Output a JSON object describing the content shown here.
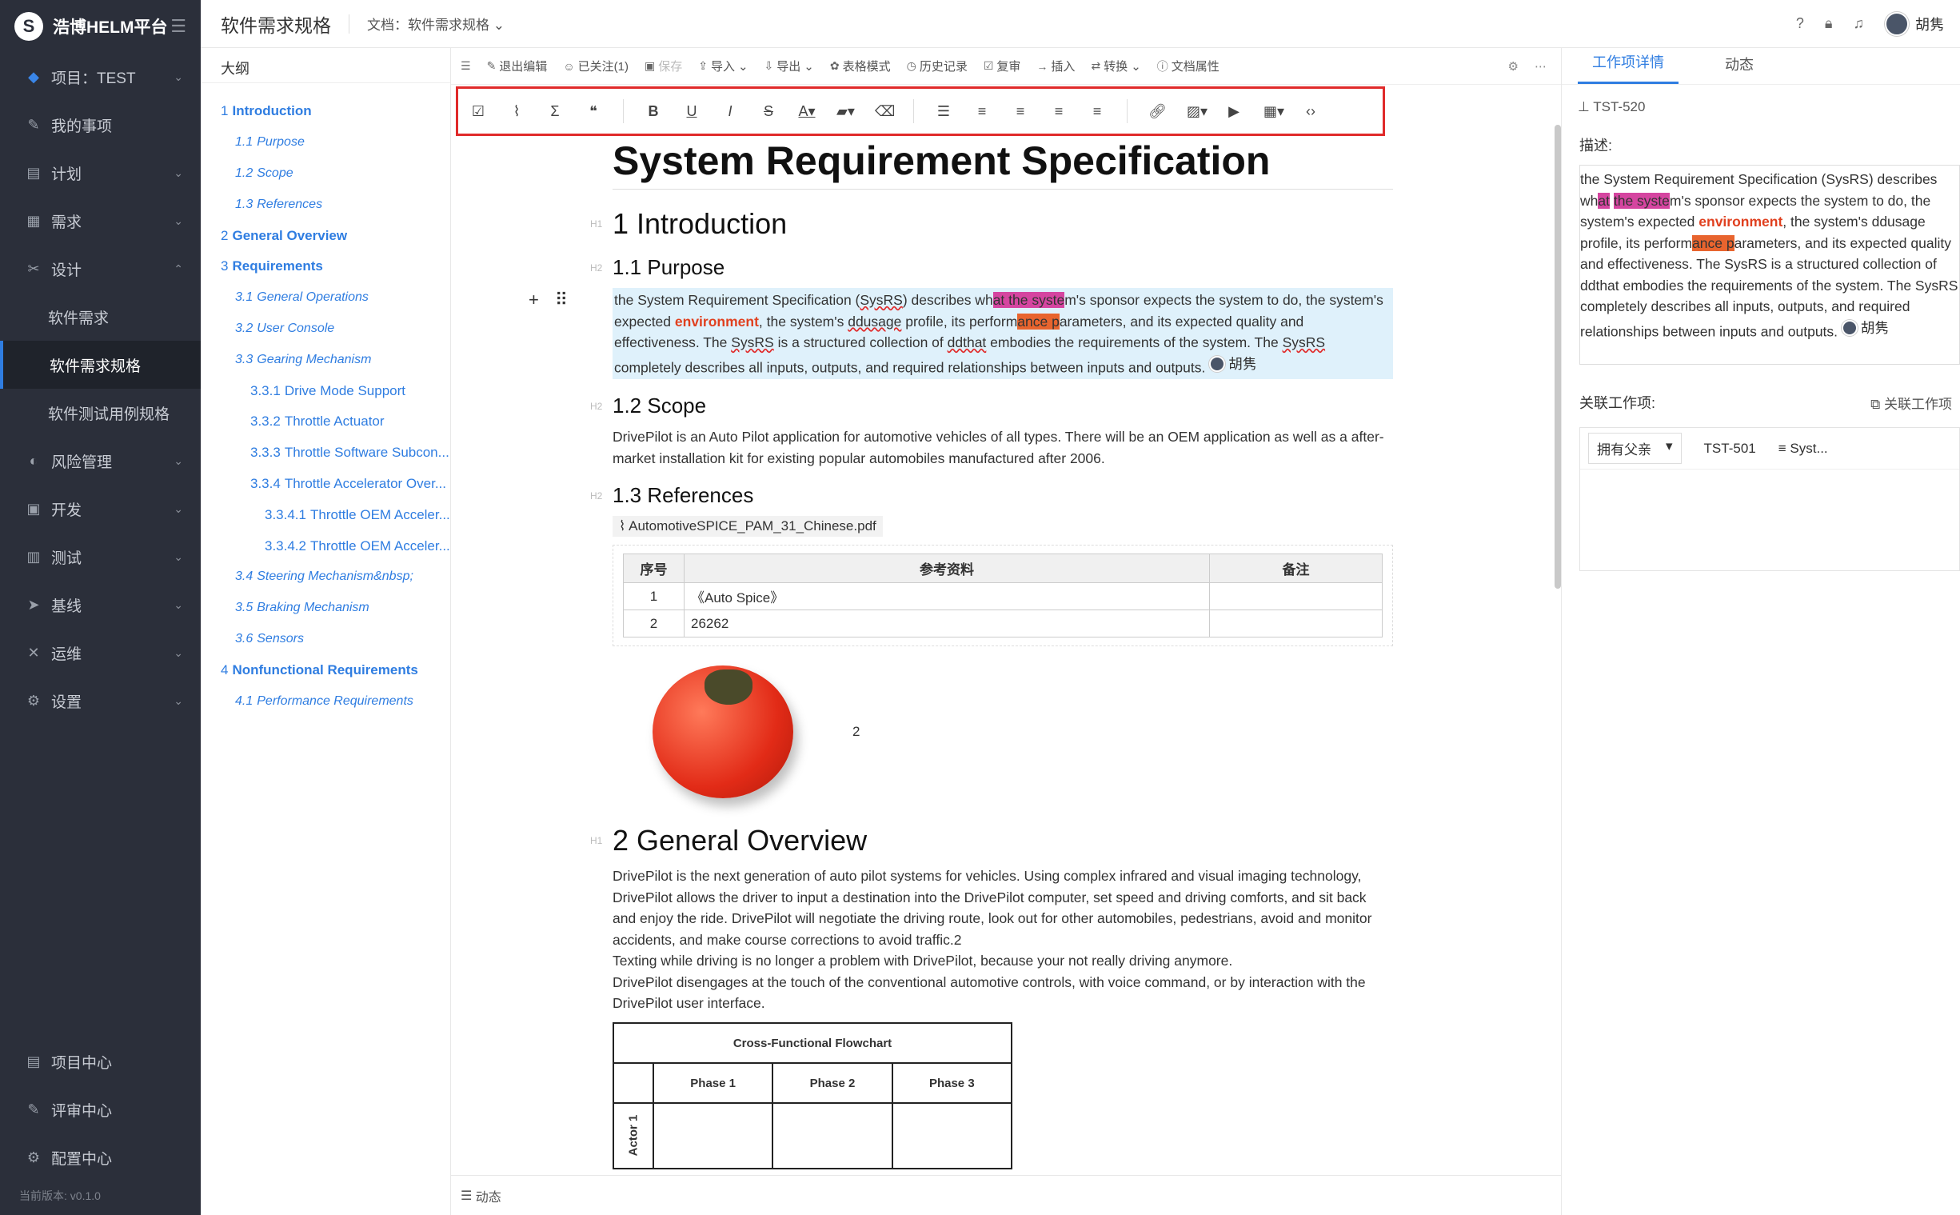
{
  "sidebar": {
    "brand": "浩博HELM平台",
    "project_label": "项目：TEST",
    "items": [
      {
        "label": "我的事项",
        "icon": "edit-icon",
        "chevron": false
      },
      {
        "label": "计划",
        "icon": "calendar-icon",
        "chevron": true
      },
      {
        "label": "需求",
        "icon": "list-icon",
        "chevron": true
      },
      {
        "label": "设计",
        "icon": "tools-icon",
        "chevron": true,
        "expanded": true
      }
    ],
    "design_sub": [
      "软件需求",
      "软件需求规格",
      "软件测试用例规格"
    ],
    "items2": [
      {
        "label": "风险管理",
        "icon": "shield-icon"
      },
      {
        "label": "开发",
        "icon": "code-icon"
      },
      {
        "label": "测试",
        "icon": "test-icon"
      },
      {
        "label": "基线",
        "icon": "send-icon"
      },
      {
        "label": "运维",
        "icon": "wrench-icon"
      },
      {
        "label": "设置",
        "icon": "gear-icon"
      }
    ],
    "bottom": [
      {
        "label": "项目中心",
        "icon": "grid-icon"
      },
      {
        "label": "评审中心",
        "icon": "edit-icon"
      },
      {
        "label": "配置中心",
        "icon": "gear-icon"
      }
    ],
    "version": "当前版本: v0.1.0"
  },
  "header": {
    "title": "软件需求规格",
    "doc_switch": "文档：软件需求规格",
    "user": "胡隽"
  },
  "outline": {
    "title": "大纲",
    "items": [
      {
        "num": "1",
        "text": "Introduction",
        "level": 1
      },
      {
        "num": "1.1",
        "text": "Purpose",
        "level": 2
      },
      {
        "num": "1.2",
        "text": "Scope",
        "level": 2
      },
      {
        "num": "1.3",
        "text": "References",
        "level": 2
      },
      {
        "num": "2",
        "text": "General Overview",
        "level": 1
      },
      {
        "num": "3",
        "text": "Requirements",
        "level": 1
      },
      {
        "num": "3.1",
        "text": "General Operations",
        "level": 2
      },
      {
        "num": "3.2",
        "text": "User Console",
        "level": 2
      },
      {
        "num": "3.3",
        "text": "Gearing Mechanism",
        "level": 2
      },
      {
        "num": "3.3.1",
        "text": "Drive Mode Support",
        "level": 3
      },
      {
        "num": "3.3.2",
        "text": "Throttle Actuator",
        "level": 3
      },
      {
        "num": "3.3.3",
        "text": "Throttle Software Subcon...",
        "level": 3
      },
      {
        "num": "3.3.4",
        "text": "Throttle Accelerator Over...",
        "level": 3
      },
      {
        "num": "3.3.4.1",
        "text": "Throttle OEM Acceler...",
        "level": 4
      },
      {
        "num": "3.3.4.2",
        "text": "Throttle OEM Acceler...",
        "level": 4
      },
      {
        "num": "3.4",
        "text": "Steering Mechanism&nbsp;",
        "level": 2
      },
      {
        "num": "3.5",
        "text": "Braking Mechanism",
        "level": 2
      },
      {
        "num": "3.6",
        "text": "Sensors",
        "level": 2
      },
      {
        "num": "4",
        "text": "Nonfunctional Requirements",
        "level": 1
      },
      {
        "num": "4.1",
        "text": "Performance Requirements",
        "level": 2
      }
    ]
  },
  "toolbar": {
    "exit_edit": "退出编辑",
    "followed": "已关注(1)",
    "save": "保存",
    "import": "导入",
    "export": "导出",
    "table_mode": "表格模式",
    "history": "历史记录",
    "review": "复审",
    "insert": "插入",
    "convert": "转换",
    "doc_props": "文档属性"
  },
  "format_buttons": [
    "checkbox-icon",
    "attachment-icon",
    "formula-icon",
    "quote-icon",
    "bold-icon",
    "underline-icon",
    "italic-icon",
    "strikethrough-icon",
    "font-color-icon",
    "highlight-icon",
    "eraser-icon",
    "bullet-list-icon",
    "numbered-list-icon",
    "align-left-icon",
    "align-right-icon",
    "align-center-icon",
    "link-icon",
    "image-icon",
    "video-icon",
    "table-icon",
    "code-icon"
  ],
  "doc": {
    "title": "System Requirement Specification",
    "h_intro": "1 Introduction",
    "h_purpose": "1.1 Purpose",
    "purpose": {
      "p1": "the System Requirement Specification (",
      "sysrs": "SysRS",
      "p2": ") describes wh",
      "hl1": "at the syste",
      "p3": "m's sponsor expects the system to do, the system's expected ",
      "env": "environment",
      "p4": ", the system's ",
      "dd": "ddusage",
      "p5": " profile, its perform",
      "hl2": "ance p",
      "p6": "arameters, and its expected quality and effectiveness. The ",
      "sysrs2": "SysRS",
      "p7": " is a structured collection of ",
      "ddthat": "ddthat",
      "p8": " embodies the requirements of the system. The ",
      "sysrs3": "SysRS",
      "p9": " completely describes all inputs, outputs, and required relationships between inputs and outputs.",
      "mention": "胡隽"
    },
    "h_scope": "1.2 Scope",
    "scope": "DrivePilot is an Auto Pilot application for automotive vehicles of all types. There will be an OEM application as well as a after-market installation kit for existing popular automobiles manufactured after 2006.",
    "h_refs": "1.3 References",
    "attachment": "AutomotiveSPICE_PAM_31_Chinese.pdf",
    "ref_table": {
      "headers": [
        "序号",
        "参考资料",
        "备注"
      ],
      "rows": [
        [
          "1",
          "《Auto Spice》",
          ""
        ],
        [
          "2",
          "26262",
          ""
        ]
      ]
    },
    "image_caption": "2",
    "h_overview": "2 General Overview",
    "overview": [
      "DrivePilot is the next generation of auto pilot systems for vehicles. Using complex infrared and visual imaging technology, DrivePilot allows the driver to input a destination into the DrivePilot computer, set speed and driving comforts, and sit back and enjoy the ride. DrivePilot will negotiate the driving route, look out for other automobiles, pedestrians, avoid and monitor accidents, and make course corrections to avoid traffic.2",
      "Texting while driving is no longer a problem with DrivePilot, because your not really driving anymore.",
      "DrivePilot disengages at the touch of the conventional automotive controls, with voice command, or by interaction with the DrivePilot user interface."
    ],
    "flowchart": {
      "title": "Cross-Functional Flowchart",
      "phases": [
        "Phase 1",
        "Phase 2",
        "Phase 3"
      ],
      "actor": "Actor 1"
    }
  },
  "editor_footer": "动态",
  "right_panel": {
    "tabs": [
      "工作项详情",
      "动态"
    ],
    "id": "TST-520",
    "desc_label": "描述:",
    "desc": {
      "a": "the System Requirement Specification (SysRS) describes wh",
      "hl1a": "at",
      "hl1b": "the syste",
      "b": "m's sponsor expects the system to do, the system's expected ",
      "env": "environment",
      "c": ", the system's ddusage profile, its perform",
      "hl2": "ance p",
      "d": "arameters, and its expected quality and effectiveness. The SysRS is a structured collection of ddthat embodies the requirements of the system. The SysRS completely describes all inputs, outputs, and required relationships between inputs and outputs.",
      "mention": "胡隽"
    },
    "related_label": "关联工作项:",
    "related_link": "关联工作项",
    "related_row": {
      "type": "拥有父亲",
      "id": "TST-501",
      "title": "Syst..."
    }
  }
}
